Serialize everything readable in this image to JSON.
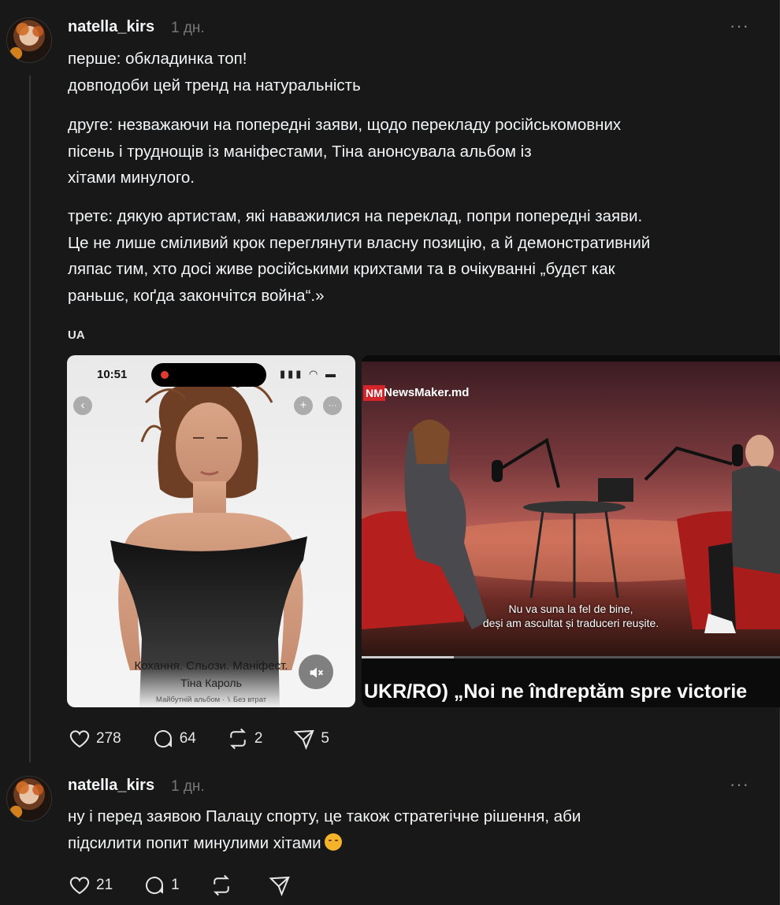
{
  "post1": {
    "username": "natella_kirs",
    "time": "1 дн.",
    "more": "···",
    "paragraphs": [
      "перше: обкладинка топ!\nдовподоби цей тренд на натуральність",
      "друге: незважаючи на попередні заяви, щодо перекладу російськомовних\nпісень і труднощів із маніфестами, Тіна анонсувала альбом із\nхітами минулого.",
      "третє: дякую артистам, які наважилися на переклад, попри попередні заяви.\nЦе не лише сміливий крок переглянути власну позицію, а й демонстративний\nляпас тим, хто досі живе російськими крихтами та в очікуванні „будєт как\nраньшє, коґда закончітся война“.»"
    ],
    "tag": "UA",
    "media1": {
      "status_time": "10:51",
      "status_icons": "▮▮▮ ◠ ▬",
      "back_icon": "‹",
      "plus_icon": "+",
      "dots_icon": "···",
      "album_title": "Кохання. Сльози. Маніфест.",
      "album_artist": "Тіна Кароль",
      "album_meta": "Майбутній альбом · ⑊ Без втрат",
      "mute_icon": "🔇"
    },
    "media2": {
      "logo": "NM",
      "logo_text": "NewsMaker.md",
      "subtitle_line1": "Nu va suna la fel de bine,",
      "subtitle_line2": "deși am ascultat și traduceri reușite.",
      "caption": "UKR/RO) „Noi ne îndreptăm spre victorie",
      "progress": 0.22
    },
    "actions": {
      "likes": "278",
      "comments": "64",
      "reposts": "2",
      "shares": "5"
    }
  },
  "post2": {
    "username": "natella_kirs",
    "time": "1 дн.",
    "more": "···",
    "text": "ну і перед заявою Палацу спорту, це також стратегічне рішення, аби\nпідсилити попит минулими хітами",
    "emoji": "face-with-rolling-eyes",
    "actions": {
      "likes": "21",
      "comments": "1",
      "reposts": "",
      "shares": ""
    }
  },
  "colors": {
    "background": "#181818",
    "text": "#f3f5f7",
    "muted": "#777777",
    "nm_red": "#d6242b"
  }
}
